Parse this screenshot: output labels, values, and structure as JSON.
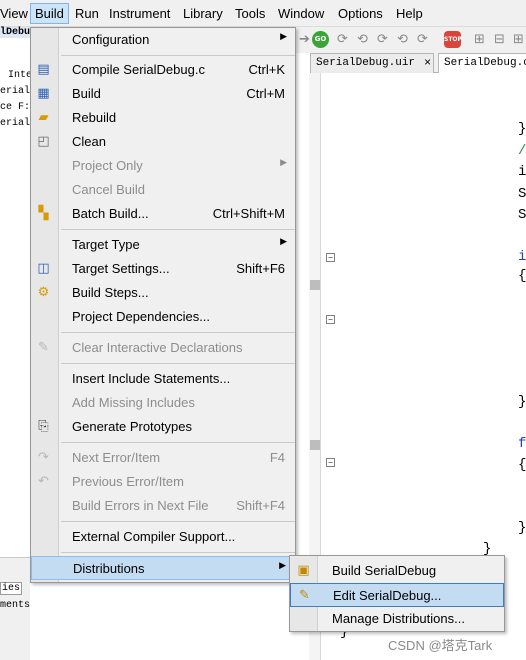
{
  "menubar": {
    "items": [
      "View",
      "Build",
      "Run",
      "Instrument",
      "Library",
      "Tools",
      "Window",
      "Options",
      "Help"
    ],
    "active": "Build"
  },
  "left_panel": {
    "lines": [
      "lDebu",
      "Inte",
      "erial",
      "ce F:",
      "erial"
    ],
    "bottom_lines": [
      "ies",
      "ments"
    ]
  },
  "toolbar": {
    "icons": [
      "go-icon",
      "step-icon",
      "stop-icon"
    ],
    "go_label": "GO",
    "stop_label": "STOP"
  },
  "tabs": [
    {
      "label": "SerialDebug.uir",
      "selected": false
    },
    {
      "label": "SerialDebug.c",
      "selected": true
    }
  ],
  "tab_close": "×",
  "code_fragments": [
    "}",
    "/",
    "i",
    "S",
    "S",
    "i",
    "{",
    "}",
    "f",
    "{",
    "}",
    "}",
    "}"
  ],
  "menu": {
    "items": [
      {
        "label": "Configuration",
        "shortcut": "",
        "submenu": true,
        "disabled": false,
        "icon": ""
      },
      {
        "label": "Compile SerialDebug.c",
        "shortcut": "Ctrl+K",
        "submenu": false,
        "disabled": false,
        "icon": "compile-icon"
      },
      {
        "label": "Build",
        "shortcut": "Ctrl+M",
        "submenu": false,
        "disabled": false,
        "icon": "build-icon"
      },
      {
        "label": "Rebuild",
        "shortcut": "",
        "submenu": false,
        "disabled": false,
        "icon": "rebuild-icon"
      },
      {
        "label": "Clean",
        "shortcut": "",
        "submenu": false,
        "disabled": false,
        "icon": "clean-icon"
      },
      {
        "label": "Project Only",
        "shortcut": "",
        "submenu": true,
        "disabled": true,
        "icon": ""
      },
      {
        "label": "Cancel Build",
        "shortcut": "",
        "submenu": false,
        "disabled": true,
        "icon": ""
      },
      {
        "label": "Batch Build...",
        "shortcut": "Ctrl+Shift+M",
        "submenu": false,
        "disabled": false,
        "icon": "batch-build-icon"
      },
      {
        "label": "Target Type",
        "shortcut": "",
        "submenu": true,
        "disabled": false,
        "icon": ""
      },
      {
        "label": "Target Settings...",
        "shortcut": "Shift+F6",
        "submenu": false,
        "disabled": false,
        "icon": "target-settings-icon"
      },
      {
        "label": "Build Steps...",
        "shortcut": "",
        "submenu": false,
        "disabled": false,
        "icon": "build-steps-icon"
      },
      {
        "label": "Project Dependencies...",
        "shortcut": "",
        "submenu": false,
        "disabled": false,
        "icon": ""
      },
      {
        "label": "Clear Interactive Declarations",
        "shortcut": "",
        "submenu": false,
        "disabled": true,
        "icon": "clear-declarations-icon"
      },
      {
        "label": "Insert Include Statements...",
        "shortcut": "",
        "submenu": false,
        "disabled": false,
        "icon": ""
      },
      {
        "label": "Add Missing Includes",
        "shortcut": "",
        "submenu": false,
        "disabled": true,
        "icon": ""
      },
      {
        "label": "Generate Prototypes",
        "shortcut": "",
        "submenu": false,
        "disabled": false,
        "icon": "generate-prototypes-icon"
      },
      {
        "label": "Next Error/Item",
        "shortcut": "F4",
        "submenu": false,
        "disabled": true,
        "icon": "next-error-icon"
      },
      {
        "label": "Previous Error/Item",
        "shortcut": "",
        "submenu": false,
        "disabled": true,
        "icon": "previous-error-icon"
      },
      {
        "label": "Build Errors in Next File",
        "shortcut": "Shift+F4",
        "submenu": false,
        "disabled": true,
        "icon": ""
      },
      {
        "label": "External Compiler Support...",
        "shortcut": "",
        "submenu": false,
        "disabled": false,
        "icon": ""
      },
      {
        "label": "Distributions",
        "shortcut": "",
        "submenu": true,
        "disabled": false,
        "icon": ""
      }
    ],
    "highlighted": "Distributions"
  },
  "submenu": {
    "items": [
      {
        "label": "Build SerialDebug",
        "icon": "build-distribution-icon"
      },
      {
        "label": "Edit SerialDebug...",
        "icon": "edit-distribution-icon"
      },
      {
        "label": "Manage Distributions...",
        "icon": ""
      }
    ],
    "highlighted": "Edit SerialDebug..."
  },
  "watermark": "CSDN @塔克Tark",
  "colors": {
    "menu_bg": "#f0f0f0",
    "highlight": "#c4dcf2",
    "highlight_border": "#3c7fc1",
    "disabled_text": "#8d8d8d"
  }
}
